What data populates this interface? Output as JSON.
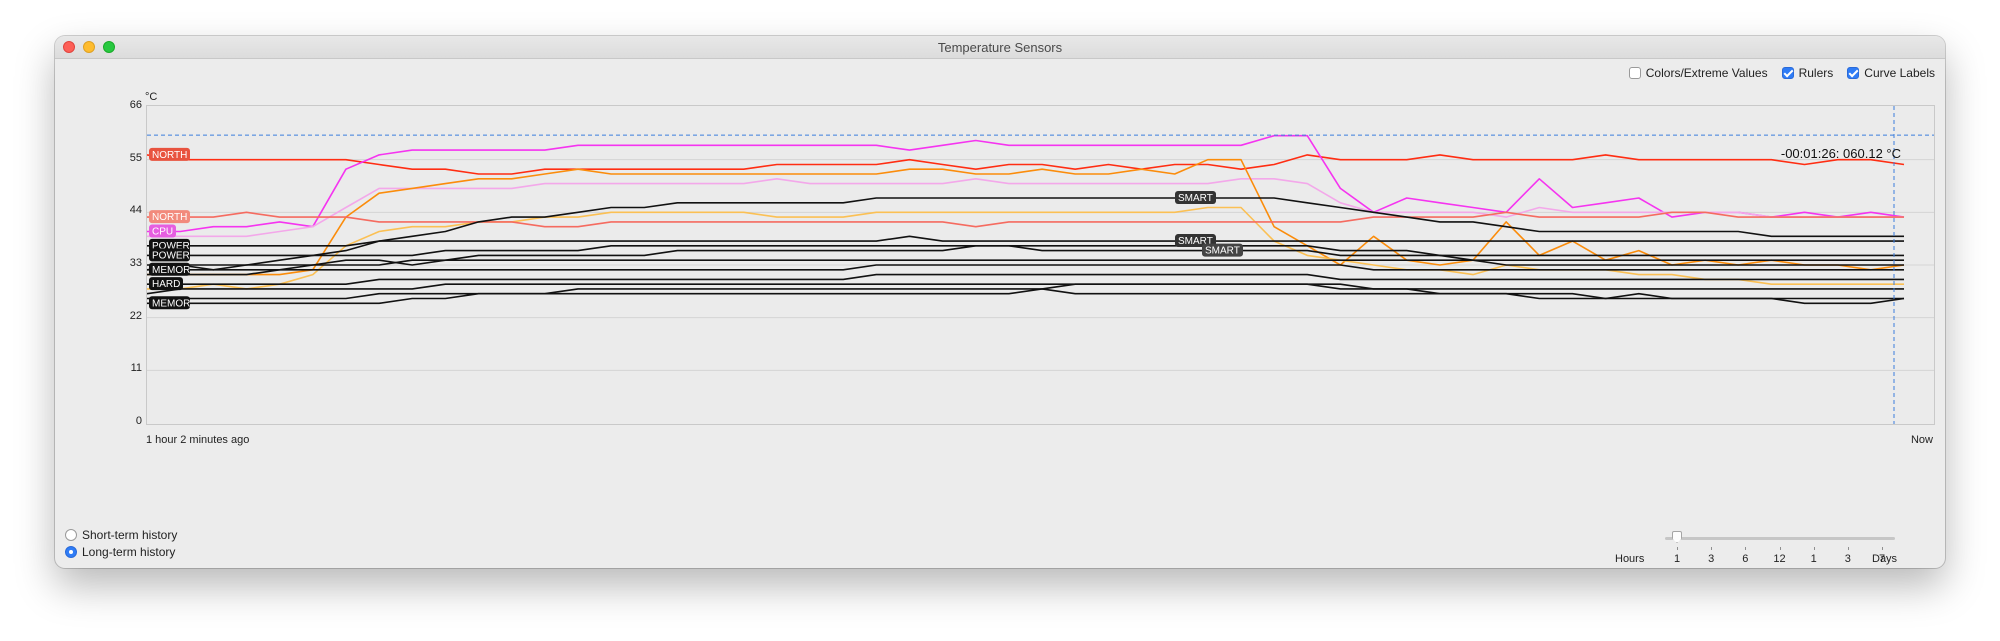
{
  "window": {
    "title": "Temperature Sensors"
  },
  "options": {
    "colors_extreme": {
      "label": "Colors/Extreme Values",
      "checked": false
    },
    "rulers": {
      "label": "Rulers",
      "checked": true
    },
    "curve_labels": {
      "label": "Curve Labels",
      "checked": true
    }
  },
  "chart": {
    "unit": "°C",
    "x_start_label": "1 hour 2 minutes  ago",
    "x_end_label": "Now",
    "readout": "-00:01:26: 060.12 °C"
  },
  "chart_data": {
    "type": "line",
    "ylabel": "°C",
    "ylim": [
      0,
      66
    ],
    "yticks": [
      0,
      11,
      22,
      33,
      44,
      55,
      66
    ],
    "x_start": "1 hour 2 minutes  ago",
    "x_end": "Now",
    "grid": true,
    "ruler_value": 60.12,
    "curve_labels": [
      "NORTH",
      "NORTH",
      "CPU",
      "POWER",
      "POWER",
      "MEMOR",
      "HARD",
      "MEMOR",
      "SMART",
      "SMART",
      "SMART"
    ],
    "series": [
      {
        "name": "",
        "color": "#ff2d12",
        "values": [
          56,
          55,
          55,
          55,
          55,
          55,
          55,
          54,
          53,
          53,
          52,
          52,
          53,
          53,
          53,
          53,
          53,
          53,
          53,
          54,
          54,
          54,
          54,
          55,
          54,
          53,
          54,
          54,
          53,
          54,
          53,
          54,
          54,
          53,
          54,
          56,
          55,
          55,
          55,
          56,
          55,
          55,
          55,
          55,
          56,
          55,
          55,
          55,
          55,
          55,
          54,
          55,
          55,
          54
        ]
      },
      {
        "name": "",
        "color": "#f534f0",
        "values": [
          40,
          40,
          41,
          41,
          42,
          41,
          53,
          56,
          57,
          57,
          57,
          57,
          57,
          58,
          58,
          58,
          58,
          58,
          58,
          58,
          58,
          58,
          58,
          57,
          58,
          59,
          58,
          58,
          58,
          58,
          58,
          58,
          58,
          58,
          60,
          60,
          49,
          44,
          47,
          46,
          45,
          44,
          51,
          45,
          46,
          47,
          43,
          44,
          44,
          43,
          44,
          43,
          44,
          43
        ]
      },
      {
        "name": "",
        "color": "#f3a8ea",
        "values": [
          39,
          39,
          39,
          39,
          40,
          41,
          45,
          49,
          49,
          49,
          49,
          49,
          50,
          50,
          50,
          50,
          50,
          50,
          50,
          51,
          50,
          50,
          50,
          50,
          50,
          51,
          50,
          50,
          50,
          50,
          50,
          50,
          50,
          51,
          51,
          50,
          46,
          44,
          44,
          44,
          44,
          43,
          45,
          44,
          44,
          44,
          44,
          44,
          44,
          43,
          43,
          43,
          43,
          43
        ]
      },
      {
        "name": "",
        "color": "#fb8c0b",
        "values": [
          31,
          31,
          31,
          31,
          31,
          32,
          43,
          48,
          49,
          50,
          51,
          51,
          52,
          53,
          52,
          52,
          52,
          52,
          52,
          52,
          52,
          52,
          52,
          53,
          53,
          52,
          52,
          53,
          52,
          52,
          53,
          52,
          55,
          55,
          41,
          37,
          33,
          39,
          34,
          33,
          34,
          42,
          35,
          38,
          34,
          36,
          33,
          34,
          33,
          34,
          33,
          33,
          32,
          33
        ]
      },
      {
        "name": "",
        "color": "#fbc054",
        "values": [
          28,
          28,
          29,
          28,
          29,
          31,
          37,
          40,
          41,
          41,
          42,
          42,
          43,
          43,
          44,
          44,
          44,
          44,
          44,
          43,
          43,
          43,
          44,
          44,
          44,
          44,
          44,
          44,
          44,
          44,
          44,
          44,
          45,
          45,
          38,
          35,
          34,
          33,
          32,
          32,
          31,
          33,
          32,
          32,
          32,
          31,
          31,
          30,
          30,
          29,
          29,
          29,
          29,
          29
        ]
      },
      {
        "name": "",
        "color": "#f56b60",
        "values": [
          43,
          43,
          43,
          44,
          43,
          43,
          43,
          42,
          42,
          42,
          42,
          42,
          41,
          41,
          42,
          42,
          42,
          42,
          42,
          42,
          42,
          42,
          42,
          42,
          42,
          41,
          42,
          42,
          42,
          42,
          42,
          42,
          42,
          42,
          42,
          42,
          42,
          43,
          43,
          43,
          43,
          44,
          43,
          43,
          43,
          43,
          44,
          44,
          43,
          43,
          43,
          43,
          43,
          43
        ]
      },
      {
        "name": "",
        "color": "#111111",
        "values": [
          32,
          33,
          32,
          33,
          34,
          35,
          36,
          38,
          39,
          40,
          42,
          43,
          43,
          44,
          45,
          45,
          46,
          46,
          46,
          46,
          46,
          46,
          47,
          47,
          47,
          47,
          47,
          47,
          47,
          47,
          47,
          47,
          47,
          47,
          47,
          46,
          45,
          44,
          43,
          42,
          42,
          41,
          40,
          40,
          40,
          40,
          40,
          40,
          40,
          39,
          39,
          39,
          39,
          39
        ]
      },
      {
        "name": "",
        "color": "#111111",
        "values": [
          37,
          37,
          37,
          37,
          37,
          37,
          37,
          38,
          38,
          38,
          38,
          38,
          38,
          38,
          38,
          38,
          38,
          38,
          38,
          38,
          38,
          38,
          38,
          39,
          38,
          38,
          38,
          38,
          38,
          38,
          38,
          38,
          38,
          38,
          38,
          38,
          38,
          38,
          38,
          38,
          38,
          38,
          38,
          38,
          38,
          38,
          38,
          38,
          38,
          38,
          38,
          38,
          38,
          38
        ]
      },
      {
        "name": "",
        "color": "#111111",
        "values": [
          35,
          35,
          35,
          35,
          35,
          35,
          35,
          35,
          35,
          36,
          36,
          36,
          36,
          36,
          37,
          37,
          37,
          37,
          37,
          37,
          37,
          37,
          37,
          37,
          37,
          37,
          37,
          37,
          37,
          37,
          37,
          37,
          37,
          37,
          37,
          37,
          36,
          36,
          36,
          35,
          35,
          35,
          35,
          35,
          35,
          35,
          35,
          35,
          35,
          35,
          35,
          35,
          35,
          35
        ]
      },
      {
        "name": "",
        "color": "#111111",
        "values": [
          33,
          33,
          33,
          33,
          33,
          33,
          34,
          34,
          33,
          34,
          35,
          35,
          35,
          35,
          35,
          35,
          36,
          36,
          36,
          36,
          36,
          36,
          36,
          36,
          36,
          37,
          37,
          36,
          36,
          36,
          36,
          36,
          36,
          36,
          36,
          36,
          35,
          35,
          35,
          35,
          34,
          34,
          34,
          34,
          34,
          34,
          34,
          34,
          34,
          34,
          34,
          34,
          34,
          34
        ]
      },
      {
        "name": "",
        "color": "#111111",
        "values": [
          32,
          32,
          32,
          32,
          32,
          33,
          33,
          33,
          34,
          34,
          34,
          34,
          34,
          34,
          34,
          34,
          34,
          34,
          34,
          34,
          34,
          34,
          34,
          34,
          34,
          34,
          34,
          34,
          34,
          34,
          34,
          34,
          34,
          34,
          34,
          34,
          34,
          34,
          34,
          34,
          34,
          33,
          33,
          33,
          33,
          33,
          33,
          33,
          33,
          33,
          33,
          33,
          33,
          33
        ]
      },
      {
        "name": "",
        "color": "#111111",
        "values": [
          31,
          31,
          31,
          31,
          32,
          32,
          32,
          32,
          32,
          32,
          32,
          32,
          32,
          32,
          32,
          32,
          32,
          32,
          32,
          32,
          32,
          32,
          33,
          33,
          33,
          33,
          33,
          33,
          33,
          33,
          33,
          33,
          33,
          33,
          33,
          33,
          33,
          32,
          32,
          32,
          32,
          32,
          32,
          32,
          32,
          32,
          32,
          32,
          32,
          32,
          32,
          32,
          32,
          32
        ]
      },
      {
        "name": "",
        "color": "#111111",
        "values": [
          29,
          29,
          29,
          29,
          29,
          29,
          29,
          30,
          30,
          30,
          30,
          30,
          30,
          30,
          30,
          30,
          30,
          30,
          30,
          30,
          30,
          30,
          31,
          31,
          31,
          31,
          31,
          31,
          31,
          31,
          31,
          31,
          31,
          31,
          31,
          31,
          30,
          30,
          30,
          30,
          30,
          30,
          30,
          30,
          30,
          30,
          30,
          30,
          30,
          30,
          30,
          30,
          30,
          30
        ]
      },
      {
        "name": "",
        "color": "#111111",
        "values": [
          27,
          28,
          28,
          28,
          28,
          28,
          28,
          28,
          28,
          29,
          29,
          29,
          29,
          29,
          29,
          29,
          29,
          29,
          29,
          29,
          29,
          29,
          29,
          29,
          29,
          29,
          29,
          29,
          29,
          29,
          29,
          29,
          29,
          29,
          29,
          29,
          28,
          28,
          28,
          28,
          28,
          28,
          28,
          28,
          28,
          28,
          28,
          28,
          28,
          28,
          28,
          28,
          28,
          28
        ]
      },
      {
        "name": "",
        "color": "#111111",
        "values": [
          26,
          26,
          26,
          26,
          26,
          26,
          26,
          27,
          27,
          27,
          27,
          27,
          27,
          27,
          27,
          27,
          27,
          27,
          27,
          27,
          27,
          27,
          27,
          27,
          27,
          27,
          27,
          28,
          27,
          27,
          27,
          27,
          27,
          27,
          27,
          27,
          27,
          27,
          27,
          27,
          27,
          27,
          26,
          26,
          26,
          26,
          26,
          26,
          26,
          26,
          26,
          26,
          26,
          26
        ]
      },
      {
        "name": "",
        "color": "#111111",
        "values": [
          25,
          25,
          25,
          25,
          25,
          25,
          25,
          25,
          26,
          26,
          27,
          27,
          27,
          28,
          28,
          28,
          28,
          28,
          28,
          28,
          28,
          28,
          28,
          28,
          28,
          28,
          28,
          28,
          29,
          29,
          29,
          29,
          29,
          29,
          29,
          29,
          29,
          28,
          28,
          27,
          27,
          27,
          27,
          27,
          26,
          27,
          26,
          26,
          26,
          26,
          25,
          25,
          25,
          26
        ]
      }
    ]
  },
  "history": {
    "short_term": {
      "label": "Short-term history",
      "selected": false
    },
    "long_term": {
      "label": "Long-term history",
      "selected": true
    }
  },
  "slider": {
    "start_label": "Hours",
    "end_label": "Days",
    "ticks": [
      "1",
      "3",
      "6",
      "12",
      "1",
      "3",
      "7"
    ],
    "value": 0
  },
  "colors": {
    "accent": "#2f7cf6",
    "ruler": "#3b7ddd"
  }
}
